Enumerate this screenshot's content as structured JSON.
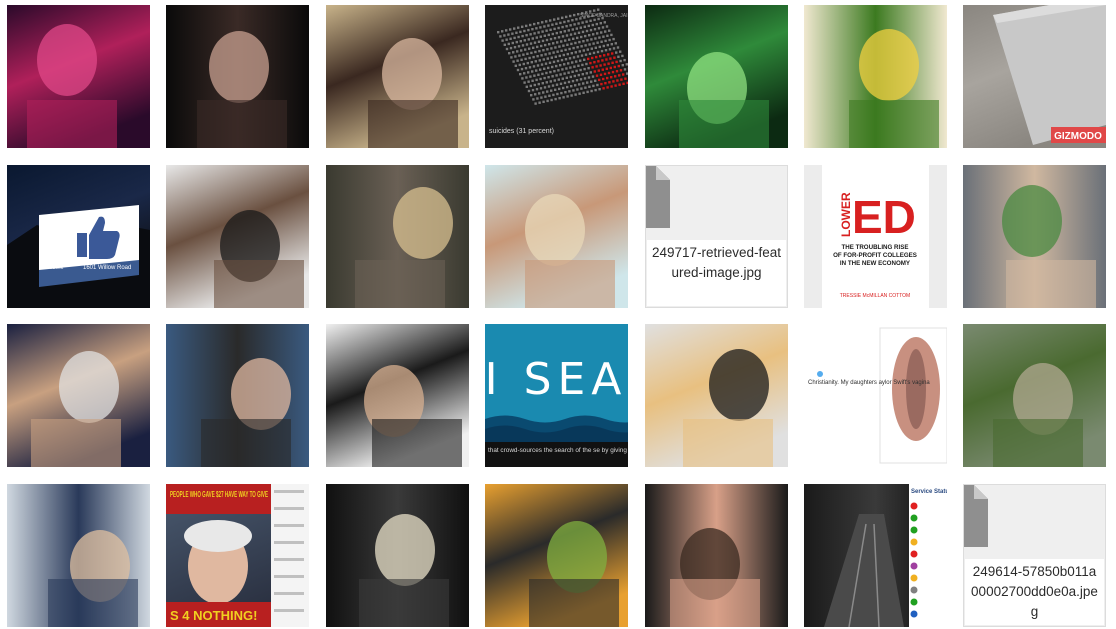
{
  "tiles": [
    {
      "name": "thumb-woman-colorful-light",
      "row": 0,
      "col": 0,
      "kind": "image",
      "colors": [
        "#2a0a2a",
        "#b0205a",
        "#e04888"
      ]
    },
    {
      "name": "thumb-man-gray-hair-suit",
      "row": 0,
      "col": 1,
      "kind": "image",
      "colors": [
        "#0a0a0a",
        "#3a2a26",
        "#c8a090"
      ]
    },
    {
      "name": "thumb-woman-portrait",
      "row": 0,
      "col": 2,
      "kind": "image",
      "colors": [
        "#c8b38a",
        "#3a2820",
        "#d9b8a0"
      ]
    },
    {
      "name": "thumb-infographic-dark",
      "row": 0,
      "col": 3,
      "kind": "infographic",
      "caption": "suicides (31 percent)",
      "header": "SINCE SANDRA, JAIL DE",
      "colors": [
        "#1c1c1c",
        "#7a7a7a",
        "#d01818"
      ]
    },
    {
      "name": "thumb-ghostbusters-team",
      "row": 0,
      "col": 4,
      "kind": "image",
      "colors": [
        "#0c2a12",
        "#2f8a3a",
        "#8fe080"
      ]
    },
    {
      "name": "thumb-green-smoothie",
      "row": 0,
      "col": 5,
      "kind": "image",
      "colors": [
        "#f0e8d0",
        "#3c7a20",
        "#f2d040"
      ]
    },
    {
      "name": "thumb-laptop-gizmodo",
      "row": 0,
      "col": 6,
      "kind": "laptop",
      "badge": "GIZMODO",
      "colors": [
        "#8a8680",
        "#c8c8c8",
        "#e04848"
      ]
    },
    {
      "name": "thumb-facebook-sign",
      "row": 1,
      "col": 0,
      "kind": "facebook-sign",
      "sign_text": "1601 Willow Road",
      "brand": "facebook",
      "colors": [
        "#0a1830",
        "#3a5a90",
        "#ffffff"
      ]
    },
    {
      "name": "thumb-man-portrait-event",
      "row": 1,
      "col": 1,
      "kind": "image",
      "colors": [
        "#e8e8e8",
        "#6a5040",
        "#1a1a1a"
      ]
    },
    {
      "name": "thumb-couple-street",
      "row": 1,
      "col": 2,
      "kind": "image",
      "colors": [
        "#3a3a30",
        "#6a6055",
        "#d8c090"
      ]
    },
    {
      "name": "thumb-beach-woman",
      "row": 1,
      "col": 3,
      "kind": "image",
      "colors": [
        "#cfe6ea",
        "#c89878",
        "#e8d8b8"
      ]
    },
    {
      "name": "thumb-file-placeholder-1",
      "row": 1,
      "col": 4,
      "kind": "file",
      "filename": "249717-retrieved-featured-image.jpg"
    },
    {
      "name": "thumb-book-lower-ed",
      "row": 1,
      "col": 5,
      "kind": "book",
      "word_a": "LOWER",
      "word_b": "ED",
      "subtitle": "THE TROUBLING RISE OF FOR-PROFIT COLLEGES IN THE NEW ECONOMY",
      "author": "TRESSIE McMILLAN COTTOM",
      "colors": [
        "#ffffff",
        "#d82020"
      ]
    },
    {
      "name": "thumb-phone-in-hand",
      "row": 1,
      "col": 6,
      "kind": "image",
      "colors": [
        "#6a7078",
        "#d0b8a0",
        "#4a8a40"
      ]
    },
    {
      "name": "thumb-trump-waving",
      "row": 2,
      "col": 0,
      "kind": "image",
      "colors": [
        "#1a2040",
        "#c8a080",
        "#e0e0e0"
      ]
    },
    {
      "name": "thumb-group-photo",
      "row": 2,
      "col": 1,
      "kind": "image",
      "colors": [
        "#3a5a80",
        "#2a2a2a",
        "#e0b8a0"
      ]
    },
    {
      "name": "thumb-woman-black-lace",
      "row": 2,
      "col": 2,
      "kind": "image",
      "colors": [
        "#f0f0f0",
        "#1a1a1a",
        "#d8b090"
      ]
    },
    {
      "name": "thumb-i-sea-app",
      "row": 2,
      "col": 3,
      "kind": "isea",
      "big_text": "I SEA",
      "caption": "that crowd-sources the search of the se by giving access to the satellite image of",
      "colors": [
        "#1a8ab0",
        "#0a4a70",
        "#ffffff"
      ]
    },
    {
      "name": "thumb-two-people-portrait",
      "row": 2,
      "col": 4,
      "kind": "image",
      "colors": [
        "#e0e0e0",
        "#e8c080",
        "#1a1a1a"
      ]
    },
    {
      "name": "thumb-tweet-screenshot",
      "row": 2,
      "col": 5,
      "kind": "tweet",
      "text": "Christianity. My daughters aylor Swift's vagina",
      "colors": [
        "#ffffff",
        "#c89080",
        "#9a6a60"
      ]
    },
    {
      "name": "thumb-car-window-blur",
      "row": 2,
      "col": 6,
      "kind": "image",
      "colors": [
        "#7a8a70",
        "#4a6a30",
        "#b0a890"
      ]
    },
    {
      "name": "thumb-leaders-painting",
      "row": 3,
      "col": 0,
      "kind": "image",
      "colors": [
        "#d0d8e0",
        "#2a3a5a",
        "#e0c0a0"
      ]
    },
    {
      "name": "thumb-bernie-meme",
      "row": 3,
      "col": 1,
      "kind": "meme",
      "top_text": "PEOPLE WHO GAVE $27 HAVE WAY TO GIVE",
      "bottom_text": "S 4 NOTHING!",
      "colors": [
        "#b82020",
        "#f0d020",
        "#e8e8e8"
      ]
    },
    {
      "name": "thumb-memorial-podium",
      "row": 3,
      "col": 2,
      "kind": "image",
      "colors": [
        "#101010",
        "#3a3a3a",
        "#e8e0c8"
      ]
    },
    {
      "name": "thumb-comic-illustration",
      "row": 3,
      "col": 3,
      "kind": "image",
      "colors": [
        "#e8a030",
        "#2a2a2a",
        "#80b040"
      ]
    },
    {
      "name": "thumb-woman-face-closeup",
      "row": 3,
      "col": 4,
      "kind": "image",
      "colors": [
        "#1a1a1a",
        "#d8a088",
        "#3a2a20"
      ]
    },
    {
      "name": "thumb-subway-tunnel",
      "row": 3,
      "col": 5,
      "kind": "subway",
      "panel_title": "Service Status",
      "colors": [
        "#2a2a2a",
        "#6a6a6a",
        "#ffffff"
      ]
    },
    {
      "name": "thumb-file-placeholder-2",
      "row": 3,
      "col": 6,
      "kind": "file",
      "filename": "249614-57850b011a00002700dd0e0a.jpeg"
    }
  ]
}
